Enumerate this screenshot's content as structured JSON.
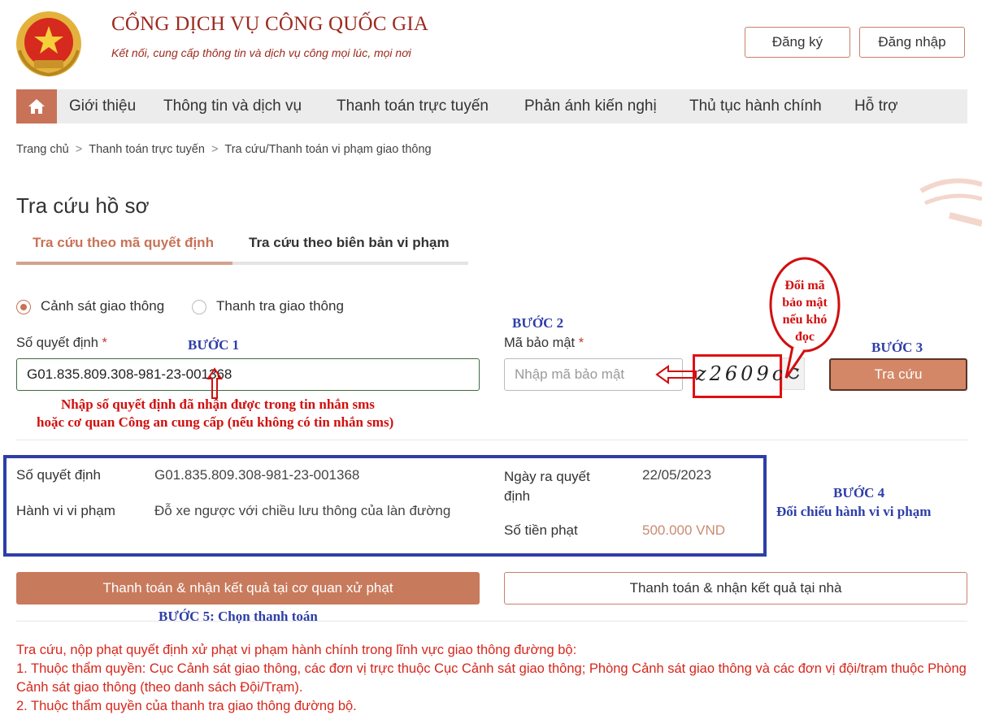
{
  "header": {
    "title": "CỔNG DỊCH VỤ CÔNG QUỐC GIA",
    "subtitle": "Kết nối, cung cấp thông tin và dịch vụ công mọi lúc, mọi nơi",
    "register_label": "Đăng ký",
    "login_label": "Đăng nhập"
  },
  "nav": {
    "items": [
      "Giới thiệu",
      "Thông tin và dịch vụ",
      "Thanh toán trực tuyến",
      "Phản ánh kiến nghị",
      "Thủ tục hành chính",
      "Hỗ trợ"
    ]
  },
  "breadcrumb": [
    "Trang chủ",
    "Thanh toán trực tuyến",
    "Tra cứu/Thanh toán vi phạm giao thông"
  ],
  "page_title": "Tra cứu hồ sơ",
  "tabs": [
    "Tra cứu theo mã quyết định",
    "Tra cứu theo biên bản vi phạm"
  ],
  "form": {
    "radio_options": [
      "Cảnh sát giao thông",
      "Thanh tra giao thông"
    ],
    "decision_label": "Số quyết định",
    "decision_value": "G01.835.809.308-981-23-001368",
    "captcha_label": "Mã bảo mật",
    "captcha_placeholder": "Nhập mã bảo mật",
    "captcha_text": "z2609cu",
    "search_label": "Tra cứu",
    "required_mark": "*"
  },
  "annotations": {
    "step1": "BƯỚC 1",
    "step2": "BƯỚC 2",
    "step3": "BƯỚC 3",
    "step4": "BƯỚC 4",
    "step4_desc": "Đối chiếu hành vi vi phạm",
    "step5": "BƯỚC 5: Chọn thanh toán",
    "note_line1": "Nhập số quyết định đã nhận được trong tin nhắn sms",
    "note_line2": "hoặc cơ quan Công an cung cấp (nếu không có tin nhắn sms)",
    "bubble_lines": [
      "Đổi mã",
      "bảo mật",
      "nếu khó",
      "đọc"
    ]
  },
  "result": {
    "decision_label": "Số quyết định",
    "decision_value": "G01.835.809.308-981-23-001368",
    "behavior_label": "Hành vi vi phạm",
    "behavior_value": "Đỗ xe ngược với chiều lưu thông của làn đường",
    "date_label_1": "Ngày ra quyết",
    "date_label_2": "định",
    "date_value": "22/05/2023",
    "fine_label": "Số tiền phạt",
    "fine_value": "500.000 VND"
  },
  "actions": {
    "pay_office_label": "Thanh toán & nhận kết quả tại cơ quan xử phạt",
    "pay_home_label": "Thanh toán & nhận kết quả tại nhà"
  },
  "footer": {
    "lines": [
      "Tra cứu, nộp phạt quyết định xử phạt vi phạm hành chính trong lĩnh vực giao thông đường bộ:",
      "1. Thuộc thẩm quyền: Cục Cảnh sát giao thông, các đơn vị trực thuộc Cục Cảnh sát giao thông; Phòng Cảnh sát giao thông và các đơn vị đội/trạm thuộc Phòng Cảnh sát giao thông (theo danh sách Đội/Trạm).",
      "2. Thuộc thẩm quyền của thanh tra giao thông đường bộ."
    ]
  },
  "colors": {
    "brand": "#c87257",
    "annotation_blue": "#2e3ea8",
    "annotation_red": "#d10f0f"
  }
}
